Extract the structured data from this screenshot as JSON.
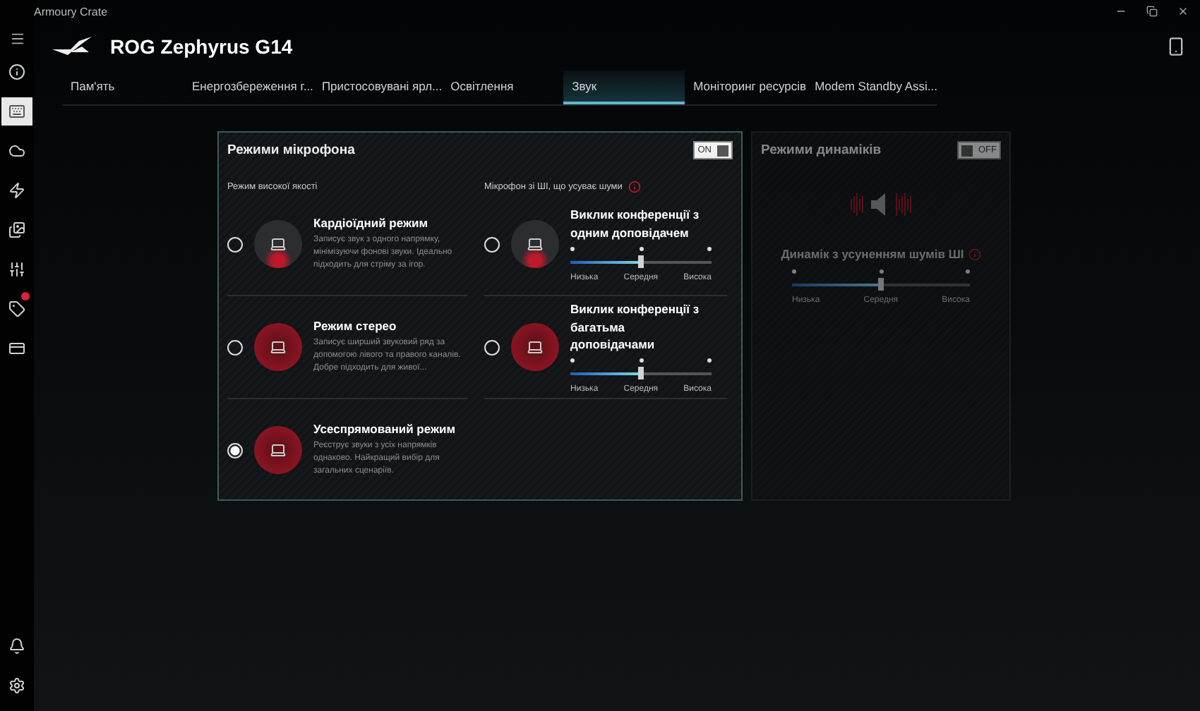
{
  "window": {
    "title": "Armoury Crate"
  },
  "device": {
    "name": "ROG Zephyrus G14"
  },
  "sidebar": {
    "items": [
      {
        "selected": false,
        "badge": false
      },
      {
        "selected": true,
        "badge": false
      },
      {
        "selected": false,
        "badge": false
      },
      {
        "selected": false,
        "badge": false
      },
      {
        "selected": false,
        "badge": false
      },
      {
        "selected": false,
        "badge": false
      },
      {
        "selected": false,
        "badge": true
      },
      {
        "selected": false,
        "badge": false
      }
    ]
  },
  "tabs": [
    {
      "label": "Пам'ять",
      "selected": false
    },
    {
      "label": "Енергозбереження г...",
      "selected": false
    },
    {
      "label": "Пристосовувані ярл...",
      "selected": false
    },
    {
      "label": "Освітлення",
      "selected": false
    },
    {
      "label": "Звук",
      "selected": true
    },
    {
      "label": "Моніторинг ресурсів",
      "selected": false
    },
    {
      "label": "Modem Standby Assi...",
      "selected": false
    }
  ],
  "mic_panel": {
    "title": "Режими мікрофона",
    "toggle": {
      "label": "ON",
      "on": true
    },
    "left_heading": "Режим високої якості",
    "right_heading": "Мікрофон зі ШІ, що усуває шуми",
    "modes": [
      {
        "title": "Кардіоїдний режим",
        "description": "Записує звук з одного напрямку, мінімізуючи фонові звуки. Ідеально підходить для стріму за ігор.",
        "selected": false
      },
      {
        "title": "Режим стерео",
        "description": "Записує ширший звуковий ряд за допомогою лівого та правого каналів. Добре підходить для живої...",
        "selected": false
      },
      {
        "title": "Усеспрямований режим",
        "description": "Реєструє звуки з усіх напрямків однаково. Найкращий вибір для загальних сценаріїв.",
        "selected": true
      }
    ],
    "ai_modes": [
      {
        "title": "Виклик конференції з одним доповідачем",
        "selected": false,
        "level": 0.5,
        "labels": [
          "Низька",
          "Середня",
          "Висока"
        ]
      },
      {
        "title": "Виклик конференції з багатьма доповідачами",
        "selected": false,
        "level": 0.5,
        "labels": [
          "Низька",
          "Середня",
          "Висока"
        ]
      }
    ]
  },
  "speaker_panel": {
    "title": "Режими динаміків",
    "toggle": {
      "label": "OFF",
      "on": false
    },
    "ai_title": "Динамік з усуненням шумів ШІ",
    "level": 0.5,
    "labels": [
      "Низька",
      "Середня",
      "Висока"
    ]
  }
}
